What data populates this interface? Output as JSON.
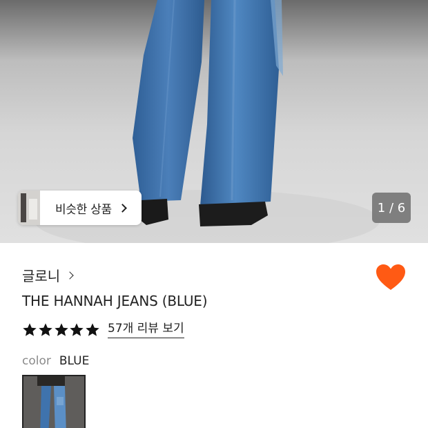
{
  "gallery": {
    "similar_products_label": "비슷한 상품",
    "page_counter": "1 / 6"
  },
  "product": {
    "brand": "글로니",
    "title": "THE HANNAH JEANS (BLUE)",
    "rating_stars": 5,
    "review_link": "57개 리뷰 보기",
    "color_label": "color",
    "color_value": "BLUE"
  },
  "colors": {
    "heart": "#ff5a14",
    "denim": "#3d6fa8"
  },
  "icons": {
    "favorite": "heart-icon",
    "star": "star-icon",
    "chevron": "chevron-right-icon"
  }
}
